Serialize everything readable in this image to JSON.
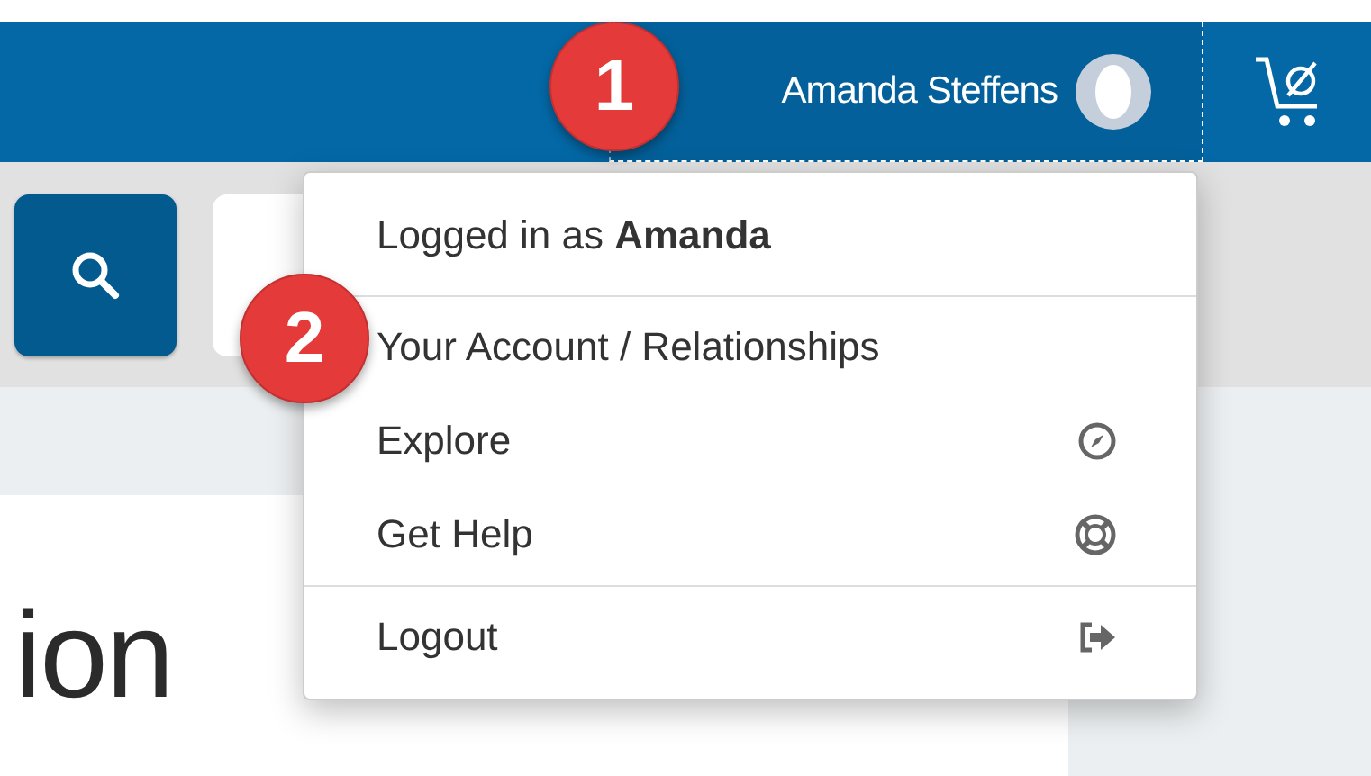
{
  "header": {
    "user_name": "Amanda Steffens"
  },
  "menu": {
    "logged_in": "Logged in as **Amanda**",
    "sections": [
      [
        {
          "label": "Your Account / Relationships",
          "kind": "plain"
        },
        {
          "label": "Explore",
          "kind": "compass"
        },
        {
          "label": "Get Help",
          "kind": "lifebuoy"
        }
      ],
      [
        {
          "label": "Logout",
          "kind": "logout"
        }
      ]
    ]
  },
  "page": {
    "heading_fragment": "ion"
  },
  "callouts": [
    "1",
    "2"
  ]
}
